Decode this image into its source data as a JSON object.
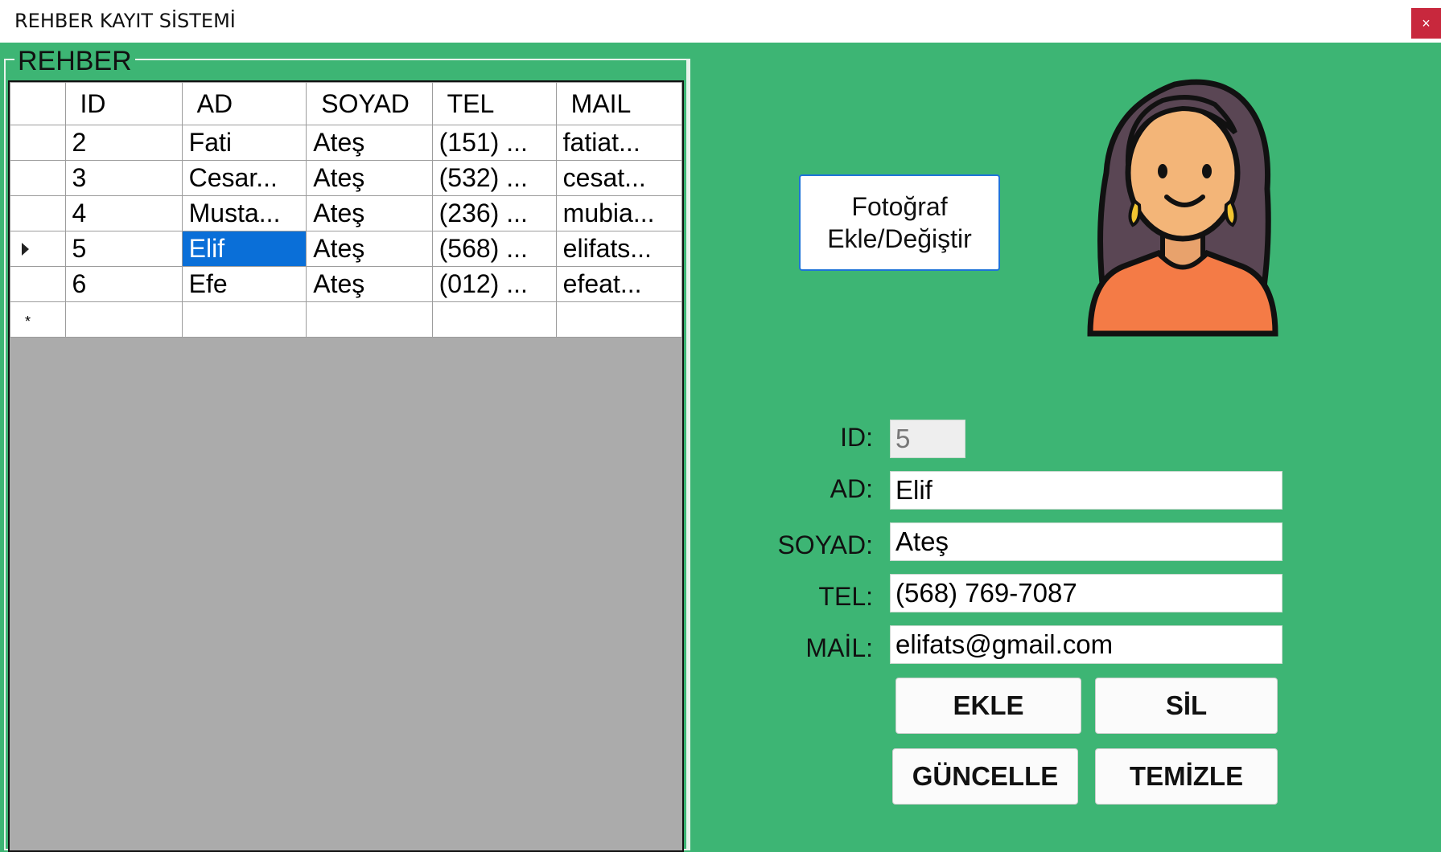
{
  "window": {
    "title": "REHBER KAYIT SİSTEMİ",
    "close_label": "×"
  },
  "group": {
    "legend": "REHBER"
  },
  "grid": {
    "columns": [
      "ID",
      "AD",
      "SOYAD",
      "TEL",
      "MAIL"
    ],
    "rows": [
      [
        "2",
        "Fati",
        "Ateş",
        "(151) ...",
        "fatiat..."
      ],
      [
        "3",
        "Cesar...",
        "Ateş",
        "(532) ...",
        "cesat..."
      ],
      [
        "4",
        "Musta...",
        "Ateş",
        "(236) ...",
        "mubia..."
      ],
      [
        "5",
        "Elif",
        "Ateş",
        "(568) ...",
        "elifats..."
      ],
      [
        "6",
        "Efe",
        "Ateş",
        "(012) ...",
        "efeat..."
      ]
    ],
    "new_row_marker": "*"
  },
  "photo_button": {
    "line1": "Fotoğraf",
    "line2": "Ekle/Değiştir"
  },
  "form": {
    "id_label": "ID:",
    "id_value": "5",
    "ad_label": "AD:",
    "ad_value": "Elif",
    "soyad_label": "SOYAD:",
    "soyad_value": "Ateş",
    "tel_label": "TEL:",
    "tel_value": "(568) 769-7087",
    "mail_label": "MAİL:",
    "mail_value": "elifats@gmail.com"
  },
  "buttons": {
    "ekle": "EKLE",
    "sil": "SİL",
    "guncelle": "GÜNCELLE",
    "temizle": "TEMİZLE"
  },
  "colors": {
    "background": "#3db574",
    "selection": "#0a6fd8",
    "grid_empty": "#ababab"
  }
}
